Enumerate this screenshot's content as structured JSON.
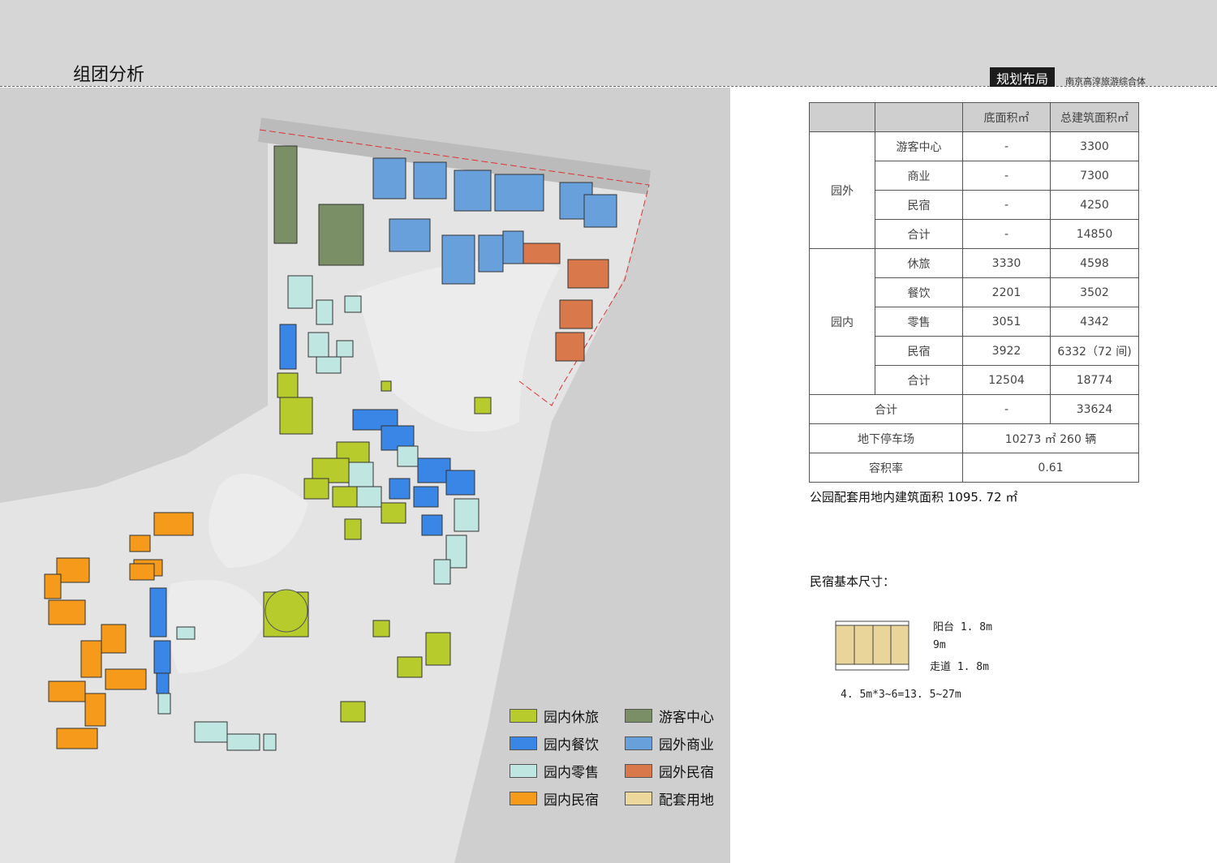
{
  "header": {
    "title": "组团分析",
    "section": "规划布局",
    "project": "南京高淳旅游综合体"
  },
  "table": {
    "headers": [
      "",
      "",
      "底面积㎡",
      "总建筑面积㎡"
    ],
    "outside": {
      "label": "园外",
      "rows": [
        [
          "游客中心",
          "-",
          "3300"
        ],
        [
          "商业",
          "-",
          "7300"
        ],
        [
          "民宿",
          "-",
          "4250"
        ],
        [
          "合计",
          "-",
          "14850"
        ]
      ]
    },
    "inside": {
      "label": "园内",
      "rows": [
        [
          "休旅",
          "3330",
          "4598"
        ],
        [
          "餐饮",
          "2201",
          "3502"
        ],
        [
          "零售",
          "3051",
          "4342"
        ],
        [
          "民宿",
          "3922",
          "6332（72 间)"
        ],
        [
          "合计",
          "12504",
          "18774"
        ]
      ]
    },
    "total": [
      "合计",
      "-",
      "33624"
    ],
    "parking": [
      "地下停车场",
      "10273 ㎡  260 辆"
    ],
    "far": [
      "容积率",
      "0.61"
    ]
  },
  "note": "公园配套用地内建筑面积 1095. 72 ㎡",
  "dimension": {
    "title": "民宿基本尺寸：",
    "balcony": "阳台 1. 8m",
    "depth": "9m",
    "corridor": "走道 1. 8m",
    "width": "4. 5m*3~6=13. 5~27m"
  },
  "legend": [
    {
      "label": "园内休旅",
      "color": "#b7cc2c"
    },
    {
      "label": "游客中心",
      "color": "#7a8f66"
    },
    {
      "label": "园内餐饮",
      "color": "#3a86e6"
    },
    {
      "label": "园外商业",
      "color": "#68a0dc"
    },
    {
      "label": "园内零售",
      "color": "#bfe6e1"
    },
    {
      "label": "园外民宿",
      "color": "#d9784a"
    },
    {
      "label": "园内民宿",
      "color": "#f59a1a"
    },
    {
      "label": "配套用地",
      "color": "#ecd79c"
    }
  ]
}
